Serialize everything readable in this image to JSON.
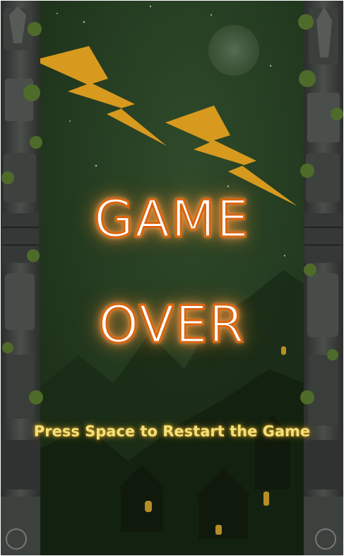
{
  "game_over": {
    "title_line_1": "GAME",
    "title_line_2": "OVER",
    "restart_hint": "Press Space to Restart the Game"
  },
  "colors": {
    "background": "#1f331b",
    "lightning": "#d79a1e",
    "title_outline": "#d9650f",
    "title_glow": "#ff9b3d",
    "hint_text": "#f3e07a",
    "stone": "#3b3f3c",
    "foliage": "#4f6b2a",
    "window_glow": "#d7a12a"
  },
  "icons": [
    "moon",
    "lightning-bolt",
    "totem-pillar",
    "house-silhouette"
  ]
}
